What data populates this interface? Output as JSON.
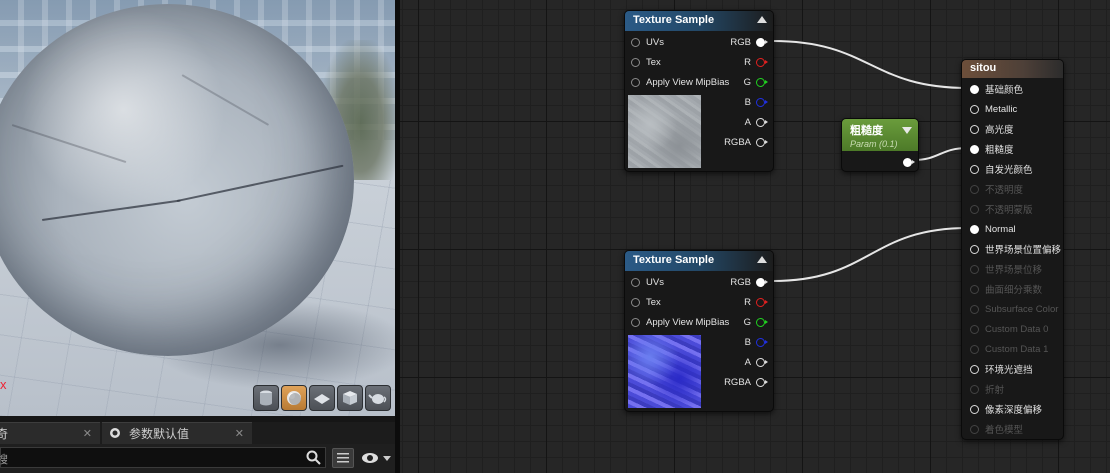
{
  "viewport": {
    "axis_label": "x",
    "tools": [
      {
        "name": "cylinder-preview",
        "active": false
      },
      {
        "name": "sphere-preview",
        "active": true
      },
      {
        "name": "plane-preview",
        "active": false
      },
      {
        "name": "cube-preview",
        "active": false
      },
      {
        "name": "teapot-preview",
        "active": false
      }
    ]
  },
  "tabs": [
    {
      "label": "奇",
      "icon": "",
      "close": "✕"
    },
    {
      "label": "参数默认值",
      "icon": "search-icon",
      "close": "✕"
    }
  ],
  "search": {
    "placeholder": "搜"
  },
  "nodes": {
    "texture1": {
      "title": "Texture Sample",
      "inputs": [
        "UVs",
        "Tex",
        "Apply View MipBias"
      ],
      "outputs": [
        "RGB",
        "R",
        "G",
        "B",
        "A",
        "RGBA"
      ]
    },
    "texture2": {
      "title": "Texture Sample",
      "inputs": [
        "UVs",
        "Tex",
        "Apply View MipBias"
      ],
      "outputs": [
        "RGB",
        "R",
        "G",
        "B",
        "A",
        "RGBA"
      ]
    },
    "param": {
      "title": "粗糙度",
      "subtitle": "Param (0.1)"
    },
    "material": {
      "title": "sitou",
      "inputs": [
        {
          "label": "基础颜色",
          "state": "connected"
        },
        {
          "label": "Metallic",
          "state": "available"
        },
        {
          "label": "高光度",
          "state": "available"
        },
        {
          "label": "粗糙度",
          "state": "connected"
        },
        {
          "label": "自发光颜色",
          "state": "available"
        },
        {
          "label": "不透明度",
          "state": "disabled"
        },
        {
          "label": "不透明蒙版",
          "state": "disabled"
        },
        {
          "label": "Normal",
          "state": "connected"
        },
        {
          "label": "世界场景位置偏移",
          "state": "available"
        },
        {
          "label": "世界场景位移",
          "state": "disabled"
        },
        {
          "label": "曲面细分乘数",
          "state": "disabled"
        },
        {
          "label": "Subsurface Color",
          "state": "disabled"
        },
        {
          "label": "Custom Data 0",
          "state": "disabled"
        },
        {
          "label": "Custom Data 1",
          "state": "disabled"
        },
        {
          "label": "环境光遮挡",
          "state": "available"
        },
        {
          "label": "折射",
          "state": "disabled"
        },
        {
          "label": "像素深度偏移",
          "state": "available"
        },
        {
          "label": "着色模型",
          "state": "disabled"
        }
      ]
    }
  }
}
